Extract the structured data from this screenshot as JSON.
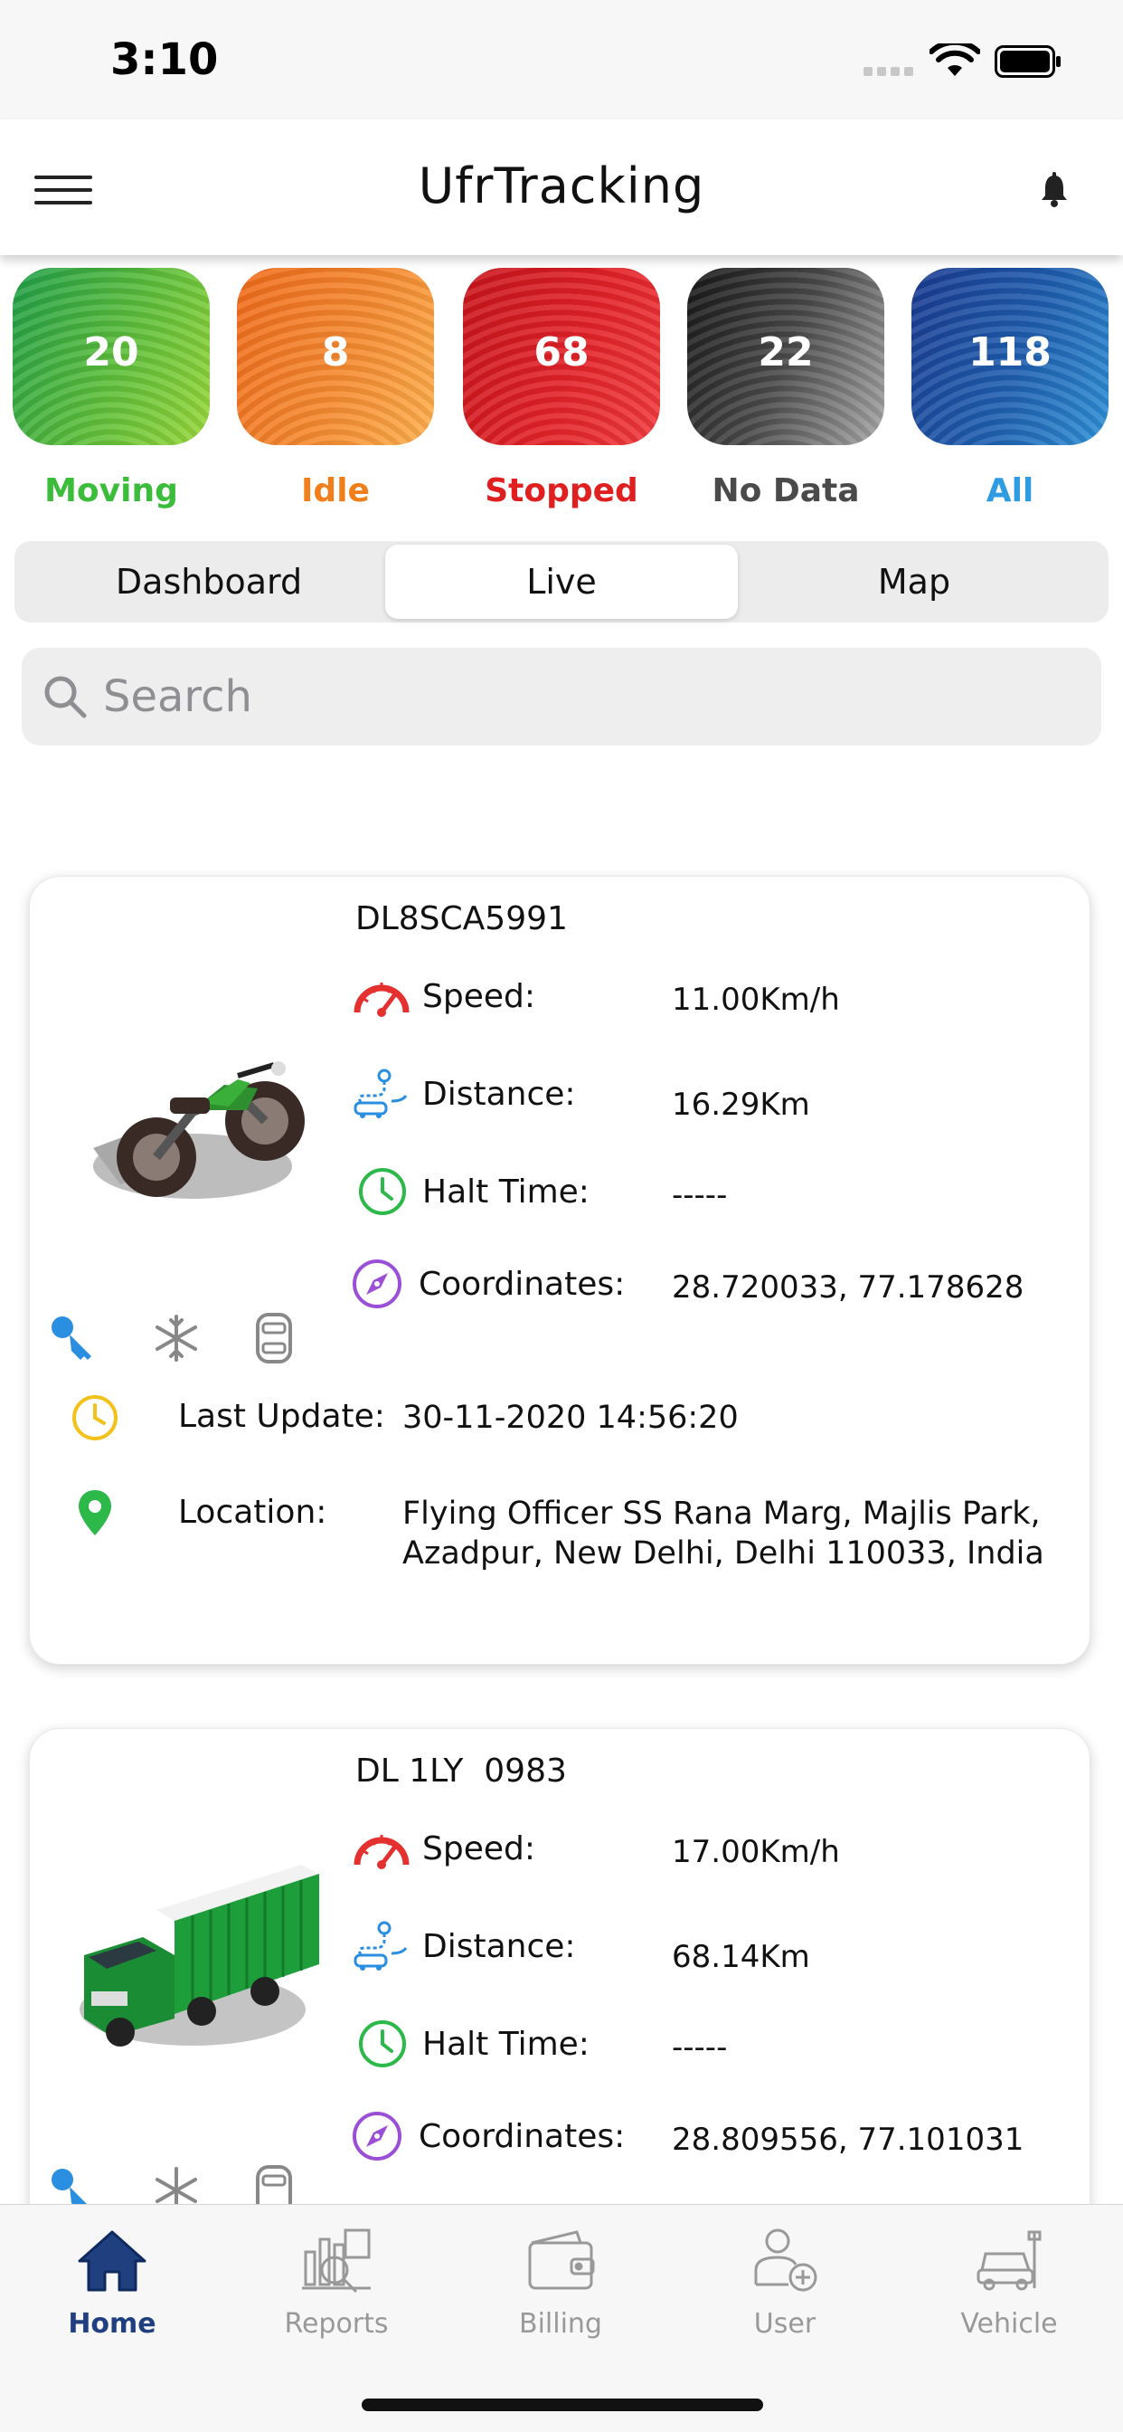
{
  "status_bar": {
    "time": "3:10"
  },
  "header": {
    "title": "UfrTracking"
  },
  "counters": [
    {
      "key": "moving",
      "count": "20",
      "label": "Moving",
      "color": "#3bbd3b",
      "gradient": [
        "#1f9e48",
        "#8ad33a"
      ]
    },
    {
      "key": "idle",
      "count": "8",
      "label": "Idle",
      "color": "#f07f1b",
      "gradient": [
        "#f06a1a",
        "#ffad4a"
      ]
    },
    {
      "key": "stopped",
      "count": "68",
      "label": "Stopped",
      "color": "#e02020",
      "gradient": [
        "#c8141b",
        "#f0383a"
      ]
    },
    {
      "key": "nodata",
      "count": "22",
      "label": "No Data",
      "color": "#4a4a4a",
      "gradient": [
        "#1a1a1a",
        "#9a9a9a"
      ]
    },
    {
      "key": "all",
      "count": "118",
      "label": "All",
      "color": "#2f9be0",
      "gradient": [
        "#1a3f96",
        "#2f8fd8"
      ]
    }
  ],
  "segments": {
    "dashboard": "Dashboard",
    "live": "Live",
    "map": "Map",
    "active": "Live"
  },
  "search": {
    "placeholder": "Search",
    "value": ""
  },
  "labels": {
    "speed": "Speed:",
    "distance": "Distance:",
    "halt": "Halt Time:",
    "coordinates": "Coordinates:",
    "last_update": "Last Update:",
    "location": "Location:"
  },
  "vehicles": [
    {
      "plate": "DL8SCA5991",
      "type": "motorcycle",
      "speed": "11.00Km/h",
      "distance": "16.29Km",
      "halt_time": "-----",
      "coordinates": "28.720033, 77.178628",
      "last_update": "30-11-2020 14:56:20",
      "location": "Flying Officer SS Rana Marg, Majlis Park, Azadpur, New Delhi, Delhi 110033, India"
    },
    {
      "plate": "DL 1LY  0983",
      "type": "truck",
      "speed": "17.00Km/h",
      "distance": "68.14Km",
      "halt_time": "-----",
      "coordinates": "28.809556, 77.101031"
    }
  ],
  "tabbar": {
    "home": "Home",
    "reports": "Reports",
    "billing": "Billing",
    "user": "User",
    "vehicle": "Vehicle",
    "active": "Home"
  },
  "colors": {
    "accent_blue": "#1f3f7e",
    "key_blue": "#2a8fe0",
    "speed_red": "#e53030",
    "halt_green": "#2db84a"
  }
}
